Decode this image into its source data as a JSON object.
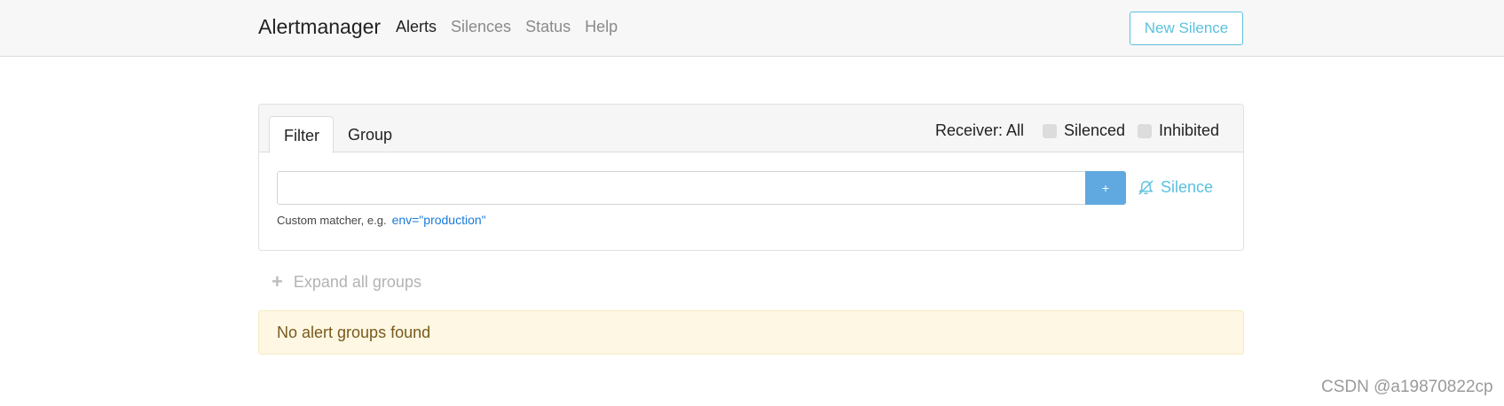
{
  "navbar": {
    "brand": "Alertmanager",
    "links": [
      "Alerts",
      "Silences",
      "Status",
      "Help"
    ],
    "new_silence": "New Silence"
  },
  "filter_card": {
    "tabs": [
      "Filter",
      "Group"
    ],
    "receiver_label": "Receiver: All",
    "silenced_label": "Silenced",
    "inhibited_label": "Inhibited",
    "input_value": "",
    "add_label": "+",
    "silence_label": "Silence",
    "hint_text": "Custom matcher, e.g.",
    "hint_code": "env=\"production\""
  },
  "expand_label": "Expand all groups",
  "empty_message": "No alert groups found",
  "watermark": "CSDN @a19870822cp",
  "colors": {
    "accent": "#5bc0de",
    "primary": "#5fa9e0",
    "warning_bg": "#fdf7e3"
  }
}
